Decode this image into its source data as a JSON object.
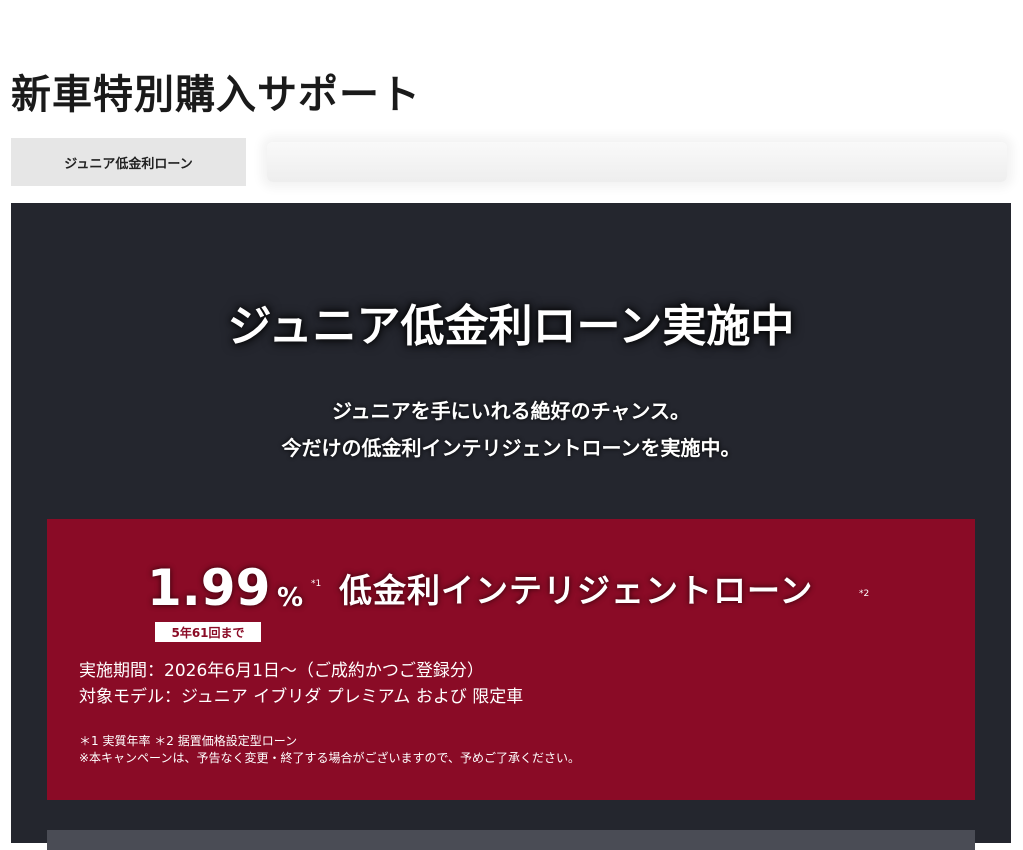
{
  "page": {
    "title": "新車特別購入サポート"
  },
  "tabs": [
    {
      "label": "ジュニア低金利ローン",
      "active": true
    }
  ],
  "hero": {
    "title": "ジュニア低金利ローン実施中",
    "subtitle_line1": "ジュニアを手にいれる絶好のチャンス。",
    "subtitle_line2": "今だけの低金利インテリジェントローンを実施中。"
  },
  "promo": {
    "rate_value": "1.99",
    "rate_unit": "%",
    "note_mark_1": "*1",
    "loan_name": "低金利インテリジェントローン",
    "note_mark_2": "*2",
    "term_badge": "5年61回まで",
    "period": "実施期間：2026年6月1日～（ご成約かつご登録分）",
    "models": "対象モデル：ジュニア イブリダ プレミアム および 限定車",
    "footnote_1": "＊1 実質年率 ＊2 据置価格設定型ローン",
    "footnote_2": "※本キャンペーンは、予告なく変更・終了する場合がございますので、予めご了承ください。"
  },
  "colors": {
    "hero_bg": "#24262e",
    "promo_bg": "#8a0b26",
    "tab_bg": "#e6e6e6"
  }
}
